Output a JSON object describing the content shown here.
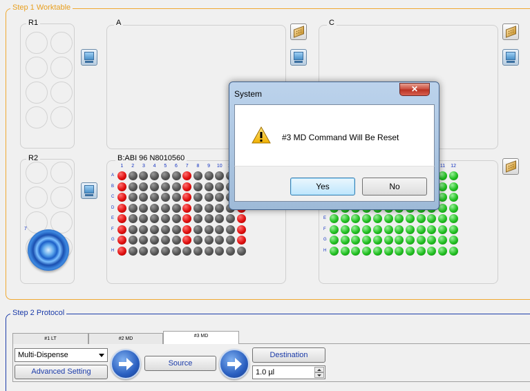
{
  "step1": {
    "legend": "Step 1 Worktable",
    "r1_label": "R1",
    "r2_label": "R2",
    "r2_slot_number": "7",
    "panel_a_label": "A",
    "panel_c_label": "C",
    "panel_b_label": "B:ABI 96 N8010560",
    "plate_rows": [
      "A",
      "B",
      "C",
      "D",
      "E",
      "F",
      "G",
      "H"
    ],
    "plate_cols": [
      "1",
      "2",
      "3",
      "4",
      "5",
      "6",
      "7",
      "8",
      "9",
      "10",
      "11",
      "12"
    ]
  },
  "step2": {
    "legend": "Step 2 Protocol",
    "tabs": [
      {
        "label": "#1 LT"
      },
      {
        "label": "#2 MD"
      },
      {
        "label": "#3 MD"
      }
    ],
    "mode_select": "Multi-Dispense",
    "advanced_label": "Advanced Setting",
    "source_label": "Source",
    "destination_label": "Destination",
    "volume_value": "1.0 µl"
  },
  "dialog": {
    "title": "System",
    "close_glyph": "✕",
    "message": "#3 MD Command Will Be Reset",
    "yes_label": "Yes",
    "no_label": "No"
  },
  "colors": {
    "step1_border": "#f0a830",
    "step2_border": "#1a3aa8",
    "well_empty": "#555555",
    "well_red": "#e01010",
    "well_green": "#22c022"
  }
}
